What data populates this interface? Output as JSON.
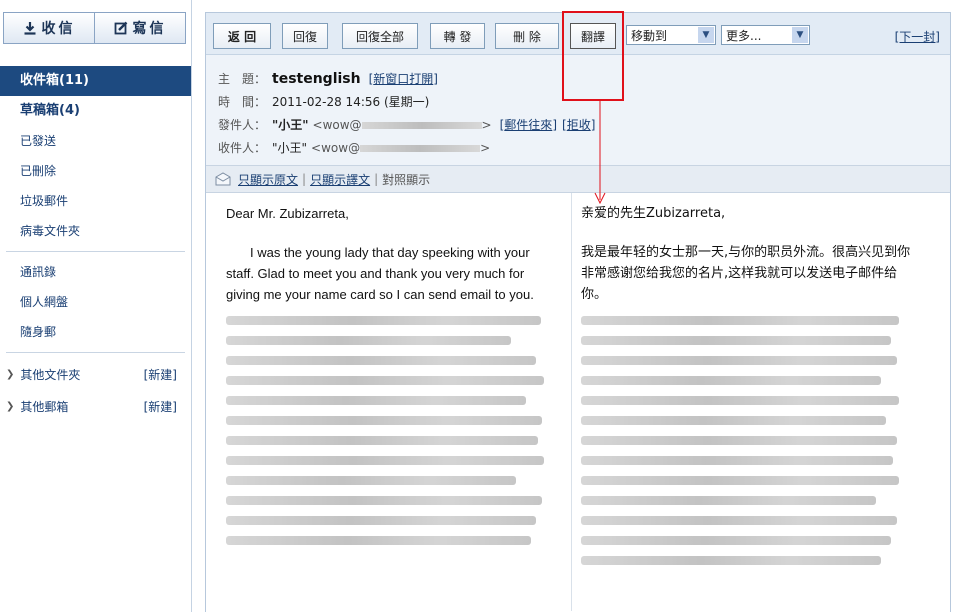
{
  "sidebar": {
    "receive_label": "收信",
    "compose_label": "寫信",
    "folders": [
      {
        "label": "收件箱(11)"
      },
      {
        "label": "草稿箱(4)"
      },
      {
        "label": "已發送"
      },
      {
        "label": "已刪除"
      },
      {
        "label": "垃圾郵件"
      },
      {
        "label": "病毒文件夾"
      }
    ],
    "tools": [
      {
        "label": "通訊錄"
      },
      {
        "label": "個人網盤"
      },
      {
        "label": "隨身郵"
      }
    ],
    "tree": [
      {
        "label": "其他文件夾",
        "action": "[新建]"
      },
      {
        "label": "其他郵箱",
        "action": "[新建]"
      }
    ]
  },
  "toolbar": {
    "back": "返 回",
    "reply": "回復",
    "reply_all": "回復全部",
    "forward": "轉 發",
    "delete": "刪 除",
    "translate": "翻譯",
    "move_to": "移動到",
    "more": "更多...",
    "next": "[下一封]"
  },
  "header": {
    "subject_label": "主　題：",
    "subject": "testenglish",
    "open_new_window": "新窗口打開",
    "time_label": "時　間：",
    "time": "2011-02-28 14:56 (星期一)",
    "from_label": "發件人：",
    "from_name": "\"小王\"",
    "from_addr_prefix": "<wow@",
    "addr_suffix": ">",
    "mail_history": "郵件往來",
    "reject": "拒收",
    "to_label": "收件人：",
    "to_name": "\"小王\"",
    "to_addr_prefix": "<wow@"
  },
  "viewbar": {
    "original_only": "只顯示原文",
    "translation_only": "只顯示譯文",
    "side_by_side": "對照顯示"
  },
  "message": {
    "greeting": "Dear Mr. Zubizarreta,",
    "body": "I was the young lady that day speeking with your staff. Glad to meet you and thank  you very much for giving me your name card so I can send email to you.",
    "greeting_translated": "亲爱的先生Zubizarreta,",
    "body_translated": "我是最年轻的女士那一天,与你的职员外流。很高兴见到你非常感谢您给我您的名片,这样我就可以发送电子邮件给你。"
  },
  "colors": {
    "active_folder": "#1d4a80",
    "link": "#1a3f73",
    "annotation": "#e0101a"
  }
}
